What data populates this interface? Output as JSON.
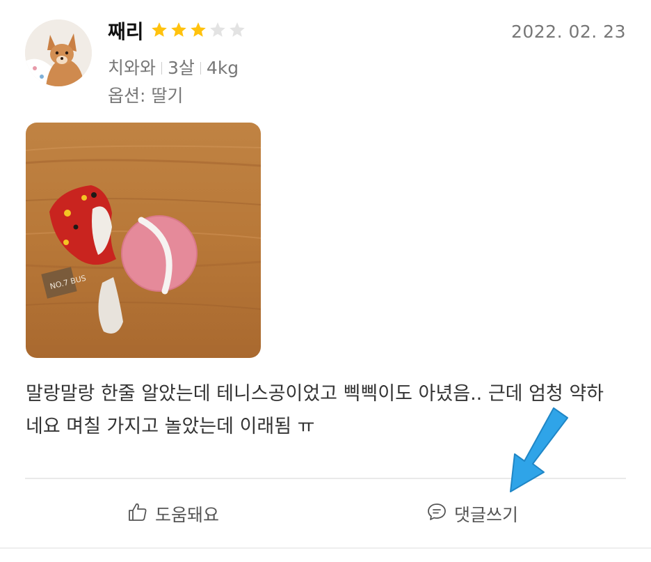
{
  "review": {
    "author": "째리",
    "rating": 3,
    "max_rating": 5,
    "date": "2022. 02. 23",
    "pet": {
      "breed": "치와와",
      "age": "3살",
      "weight": "4kg"
    },
    "option": "옵션: 딸기",
    "text": "말랑말랑 한줄 알았는데 테니스공이었고 삑삑이도 아녔음.. 근데 엄청 약하네요 며칠 가지고 놀았는데 이래됨 ㅠ",
    "photo_tag": "NO.7 BUS"
  },
  "actions": {
    "helpful_label": "도움돼요",
    "comment_label": "댓글쓰기"
  },
  "colors": {
    "star_filled": "#FFC20E",
    "star_empty": "#E3E3E3",
    "arrow": "#2FA4E8"
  }
}
